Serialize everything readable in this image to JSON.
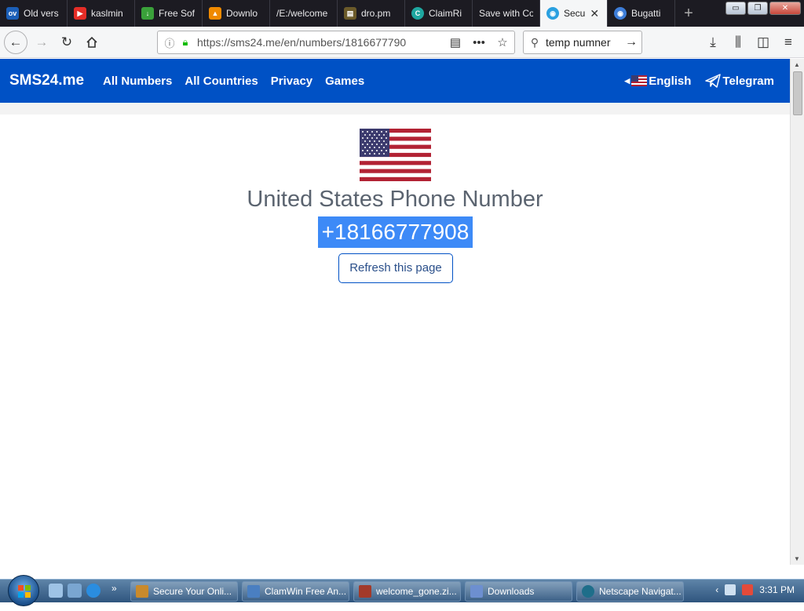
{
  "browser": {
    "tabs": [
      {
        "label": "Old vers",
        "icon": "ov-icon",
        "color": "#1b5fb8",
        "glyph": "ov"
      },
      {
        "label": "kaslmin",
        "icon": "youtube-icon",
        "color": "#e52d27",
        "glyph": "▶"
      },
      {
        "label": "Free Sof",
        "icon": "download-icon",
        "color": "#3aa13a",
        "glyph": "↓"
      },
      {
        "label": "Downlo",
        "icon": "vlc-icon",
        "color": "#f08a00",
        "glyph": "▲"
      },
      {
        "label": "/E:/welcome",
        "icon": "",
        "color": "",
        "glyph": ""
      },
      {
        "label": "dro.pm",
        "icon": "dropm-icon",
        "color": "#6b5a2a",
        "glyph": "▤"
      },
      {
        "label": "ClaimRi",
        "icon": "claimrig-icon",
        "color": "#1ea7a0",
        "glyph": "C"
      },
      {
        "label": "Save with Co",
        "icon": "",
        "color": "",
        "glyph": ""
      },
      {
        "label": "Secu",
        "icon": "shield-icon",
        "color": "#2aa0e0",
        "glyph": "◉",
        "active": true
      },
      {
        "label": "Bugatti",
        "icon": "bugatti-icon",
        "color": "#3d7dd8",
        "glyph": "◉"
      }
    ],
    "url": "https://sms24.me/en/numbers/1816677790",
    "search_value": "temp numner"
  },
  "site": {
    "brand": "SMS24.me",
    "nav": [
      "All Numbers",
      "All Countries",
      "Privacy",
      "Games"
    ],
    "language": "English",
    "telegram": "Telegram"
  },
  "main": {
    "title": "United States Phone Number",
    "phone": "+18166777908",
    "refresh_label": "Refresh this page"
  },
  "taskbar": {
    "tasks": [
      {
        "label": "Secure Your Onli...",
        "color": "#c98a2c"
      },
      {
        "label": "ClamWin Free An...",
        "color": "#4a7fc1"
      },
      {
        "label": "welcome_gone.zi...",
        "color": "#a23a2a"
      },
      {
        "label": "Downloads",
        "color": "#6d8fd0"
      },
      {
        "label": "Netscape Navigat...",
        "color": "#1e6e8a"
      }
    ],
    "time": "3:31 PM"
  },
  "colors": {
    "site_header": "#0051c5",
    "selection": "#3d8af7",
    "tab_strip": "#1c1b22"
  }
}
